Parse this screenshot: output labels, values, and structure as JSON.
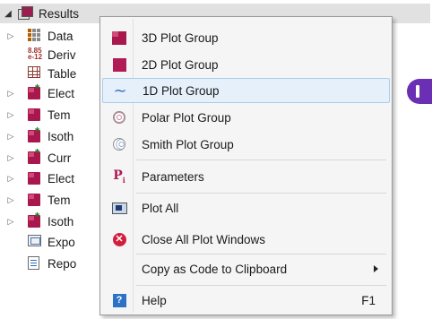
{
  "tree": {
    "root": {
      "label": "Results",
      "icon": "results-icon",
      "expanded": true
    },
    "items": [
      {
        "label": "Data",
        "icon": "data-icon",
        "expandable": true
      },
      {
        "label": "Deriv",
        "icon": "derived-values-icon",
        "expandable": false
      },
      {
        "label": "Table",
        "icon": "table-icon",
        "expandable": false
      },
      {
        "label": "Elect",
        "icon": "plot-group-star-icon",
        "expandable": true
      },
      {
        "label": "Tem",
        "icon": "plot-group-icon",
        "expandable": true
      },
      {
        "label": "Isoth",
        "icon": "plot-group-star-icon",
        "expandable": true
      },
      {
        "label": "Curr",
        "icon": "plot-group-star-icon",
        "expandable": true
      },
      {
        "label": "Elect",
        "icon": "plot-group-icon",
        "expandable": true
      },
      {
        "label": "Tem",
        "icon": "plot-group-icon",
        "expandable": true
      },
      {
        "label": "Isoth",
        "icon": "plot-group-star-icon",
        "expandable": true
      },
      {
        "label": "Expo",
        "icon": "export-icon",
        "expandable": false
      },
      {
        "label": "Repo",
        "icon": "report-icon",
        "expandable": false
      }
    ]
  },
  "context_menu": {
    "items": [
      {
        "label": "3D Plot Group",
        "icon": "3d-plot-group-icon"
      },
      {
        "label": "2D Plot Group",
        "icon": "2d-plot-group-icon"
      },
      {
        "label": "1D Plot Group",
        "icon": "1d-plot-group-icon",
        "highlighted": true
      },
      {
        "label": "Polar Plot Group",
        "icon": "polar-plot-group-icon"
      },
      {
        "label": "Smith Plot Group",
        "icon": "smith-plot-group-icon"
      },
      {
        "label": "Parameters",
        "icon": "parameters-icon"
      },
      {
        "label": "Plot All",
        "icon": "plot-all-icon"
      },
      {
        "label": "Close All Plot Windows",
        "icon": "close-all-icon"
      },
      {
        "label": "Copy as Code to Clipboard",
        "icon": "",
        "submenu": true
      },
      {
        "label": "Help",
        "icon": "help-icon",
        "shortcut": "F1"
      }
    ]
  },
  "colors": {
    "accent": "#a8174d",
    "highlight_bg": "#e5f0fb",
    "highlight_border": "#a8cbef",
    "badge": "#6a2fb3"
  }
}
